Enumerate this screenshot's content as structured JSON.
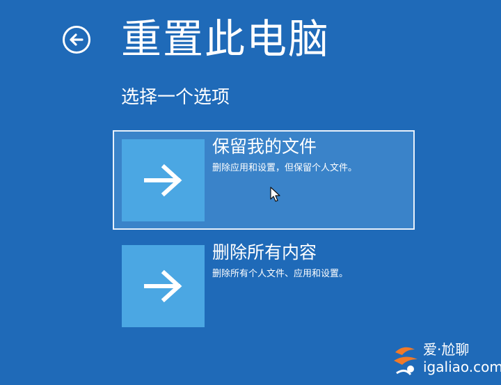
{
  "page": {
    "title": "重置此电脑",
    "subtitle": "选择一个选项"
  },
  "options": [
    {
      "title": "保留我的文件",
      "description": "删除应用和设置，但保留个人文件。",
      "icon": "arrow-right-icon",
      "selected": true
    },
    {
      "title": "删除所有内容",
      "description": "删除所有个人文件、应用和设置。",
      "icon": "arrow-right-icon",
      "selected": false
    }
  ],
  "watermark": {
    "brand": "爱·尬聊",
    "domain": "igaliao.com"
  },
  "colors": {
    "background": "#1f6ab8",
    "tile": "#4ba7e3",
    "selected_fill": "#3a83c9",
    "selected_border": "#e8f1fb",
    "watermark_accent": "#f07a2a"
  }
}
